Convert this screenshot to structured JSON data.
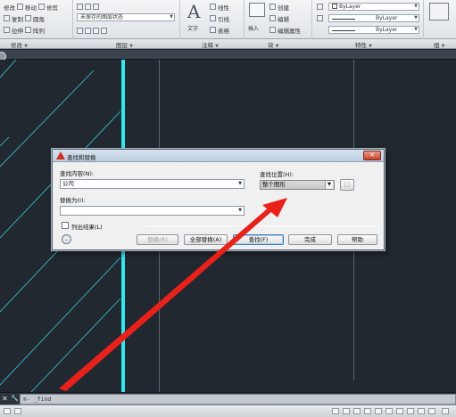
{
  "ribbon": {
    "modify": {
      "rows": [
        {
          "items": [
            "修改",
            "移动",
            "修剪"
          ],
          "icons": [
            "move-icon",
            "trim-icon"
          ]
        },
        {
          "items": [
            "复制",
            "圆角"
          ],
          "icons": [
            "copy-icon",
            "fillet-icon"
          ]
        },
        {
          "items": [
            "拉伸",
            "阵列"
          ],
          "icons": [
            "stretch-icon",
            "array-icon"
          ]
        }
      ],
      "label": "修改"
    },
    "layer": {
      "combo_value": "未保存的图层状态",
      "label": "图层"
    },
    "annotation": {
      "text_label": "文字",
      "rows": [
        "线性",
        "引线",
        "表格"
      ],
      "label": "注释"
    },
    "block": {
      "insert_label": "插入",
      "rows": [
        "创建",
        "编辑",
        "编辑属性"
      ],
      "label": "块"
    },
    "properties": {
      "color_value": "ByLayer",
      "linetype_value": "ByLayer",
      "lineweight_value": "ByLayer",
      "label": "特性"
    },
    "group_label": "组"
  },
  "dialog": {
    "title": "查找和替换",
    "find_label": "查找内容(N):",
    "find_value": "公司",
    "replace_label": "替换为(I):",
    "replace_value": "",
    "where_label": "查找位置(H):",
    "where_value": "整个图形",
    "list_results_label": "列出结果(L)",
    "buttons": {
      "replace": "替换(R)",
      "replace_all": "全部替换(A)",
      "find": "查找(F)",
      "done": "完成",
      "help": "帮助"
    }
  },
  "command_line": {
    "prompt": "≋- _find"
  },
  "colors": {
    "canvas_bg": "#212830",
    "hatch_line": "#39c9d6",
    "cyan_line": "#32e6f0",
    "arrow": "#e8211b"
  }
}
